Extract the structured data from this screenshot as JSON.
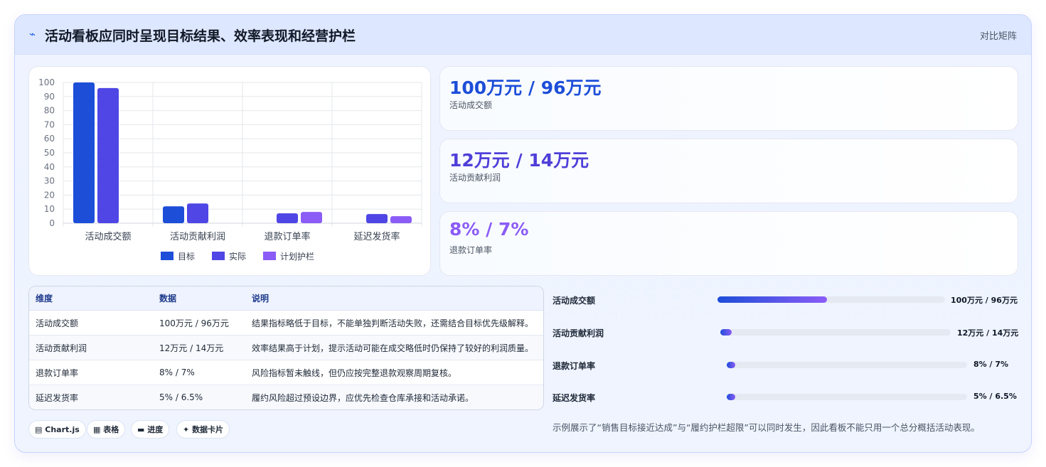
{
  "header": {
    "icon": "sparkle-icon",
    "title": "活动看板应同时呈现目标结果、效率表现和经营护栏",
    "right_label": "对比矩阵"
  },
  "kpis": [
    {
      "value": "100万元 / 96万元",
      "label": "活动成交额",
      "color": "#1d4ed8"
    },
    {
      "value": "12万元 / 14万元",
      "label": "活动贡献利润",
      "color": "#4f3fd8"
    },
    {
      "value": "8% / 7%",
      "label": "退款订单率",
      "color": "#8b5cf6"
    }
  ],
  "table": {
    "headers": [
      "维度",
      "数据",
      "说明"
    ],
    "rows": [
      [
        "活动成交额",
        "100万元 / 96万元",
        "结果指标略低于目标，不能单独判断活动失败，还需结合目标优先级解释。"
      ],
      [
        "活动贡献利润",
        "12万元 / 14万元",
        "效率结果高于计划，提示活动可能在成交略低时仍保持了较好的利润质量。"
      ],
      [
        "退款订单率",
        "8% / 7%",
        "风险指标暂未触线，但仍应按完整退款观察周期复核。"
      ],
      [
        "延迟发货率",
        "5% / 6.5%",
        "履约风险超过预设边界，应优先检查仓库承接和活动承诺。"
      ]
    ]
  },
  "tags": [
    {
      "icon": "chart-icon",
      "glyph": "▤",
      "label": "Chart.js"
    },
    {
      "icon": "table-icon",
      "glyph": "▦",
      "label": "表格"
    },
    {
      "icon": "progress-icon",
      "glyph": "▬",
      "label": "进度"
    },
    {
      "icon": "card-icon",
      "glyph": "✦",
      "label": "数据卡片"
    }
  ],
  "progress": [
    {
      "name": "活动成交额",
      "value_text": "100万元 / 96万元",
      "fraction": 0.48
    },
    {
      "name": "活动贡献利润",
      "value_text": "12万元 / 14万元",
      "fraction": 0.05
    },
    {
      "name": "退款订单率",
      "value_text": "8% / 7%",
      "fraction": 0.03
    },
    {
      "name": "延迟发货率",
      "value_text": "5% / 6.5%",
      "fraction": 0.03
    }
  ],
  "note": "示例展示了“销售目标接近达成”与“履约护栏超限”可以同时发生，因此看板不能只用一个总分概括活动表现。",
  "chart_data": {
    "type": "bar",
    "categories": [
      "活动成交额",
      "活动贡献利润",
      "退款订单率",
      "延迟发货率"
    ],
    "series": [
      {
        "name": "目标",
        "values": [
          100,
          12,
          0,
          0
        ],
        "color": "#1d4ed8"
      },
      {
        "name": "实际",
        "values": [
          96,
          14,
          7,
          6.5
        ],
        "color": "#4f46e5"
      },
      {
        "name": "计划护栏",
        "values": [
          0,
          0,
          8,
          5
        ],
        "color": "#8b5cf6"
      }
    ],
    "ylim": [
      0,
      100
    ],
    "yticks": [
      0,
      10,
      20,
      30,
      40,
      50,
      60,
      70,
      80,
      90,
      100
    ],
    "grid": true,
    "legend": "bottom"
  }
}
